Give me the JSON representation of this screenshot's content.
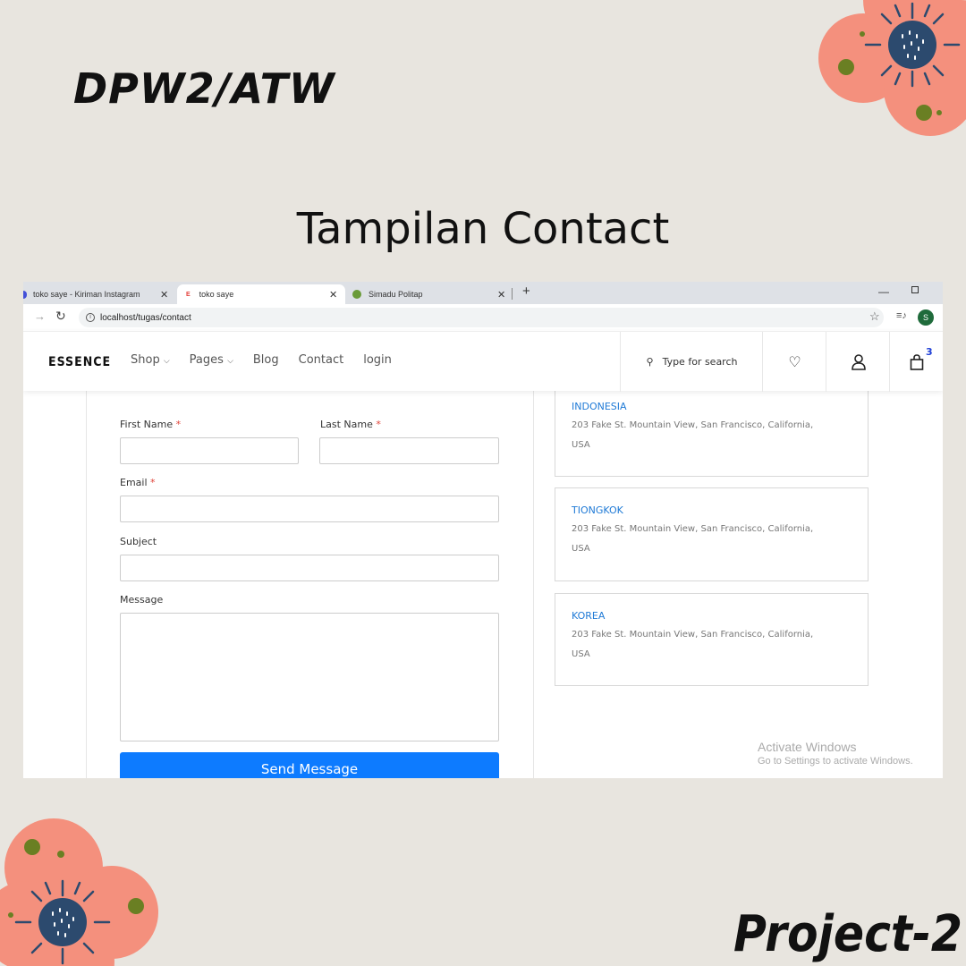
{
  "slide": {
    "course": "DPW2/ATW",
    "title": "Tampilan Contact",
    "project": "Project-2"
  },
  "browser": {
    "tabs": [
      {
        "label": "toko saye - Kiriman Instagram"
      },
      {
        "label": "toko saye",
        "favicon": "E"
      },
      {
        "label": "Simadu Politap"
      }
    ],
    "url": "localhost/tugas/contact",
    "profile_initial": "S"
  },
  "site": {
    "logo": "ESSENCE",
    "menu": {
      "shop": "Shop",
      "pages": "Pages",
      "blog": "Blog",
      "contact": "Contact",
      "login": "login"
    },
    "search_placeholder": "Type for search",
    "cart_count": "3"
  },
  "form": {
    "first_name": "First Name",
    "last_name": "Last Name",
    "email": "Email",
    "subject": "Subject",
    "message": "Message",
    "required_mark": "*",
    "submit": "Send Message"
  },
  "locations": [
    {
      "name": "INDONESIA",
      "address": "203 Fake St. Mountain View, San Francisco, California,",
      "country": "USA"
    },
    {
      "name": "TIONGKOK",
      "address": "203 Fake St. Mountain View, San Francisco, California,",
      "country": "USA"
    },
    {
      "name": "KOREA",
      "address": "203 Fake St. Mountain View, San Francisco, California,",
      "country": "USA"
    }
  ],
  "watermark": {
    "line1": "Activate Windows",
    "line2": "Go to Settings to activate Windows."
  },
  "colors": {
    "background": "#e8e5df",
    "accent_button": "#0d7bff",
    "location_title": "#1f7ad6",
    "flower_petal": "#f4907d",
    "flower_center": "#2c4a6e"
  }
}
